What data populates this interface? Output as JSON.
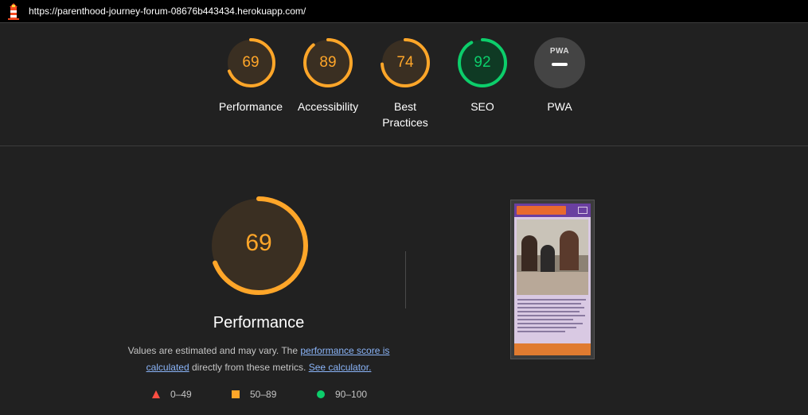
{
  "browser": {
    "url": "https://parenthood-journey-forum-08676b443434.herokuapp.com/"
  },
  "colors": {
    "average": "#ffa629",
    "pass": "#0cce6b",
    "fail": "#ff4e42",
    "link": "#8ab4f8"
  },
  "scores": [
    {
      "label": "Performance",
      "score": 69
    },
    {
      "label": "Accessibility",
      "score": 89
    },
    {
      "label": "Best Practices",
      "score": 74
    },
    {
      "label": "SEO",
      "score": 92
    }
  ],
  "pwa": {
    "label": "PWA",
    "badge_text": "PWA"
  },
  "performance": {
    "score": 69,
    "title": "Performance",
    "desc_1": "Values are estimated and may vary. The ",
    "link_1": "performance score is calculated",
    "desc_2": " directly from these metrics. ",
    "link_2": "See calculator."
  },
  "legend": [
    {
      "range": "0–49",
      "shape": "triangle",
      "icon": "fail-triangle-icon"
    },
    {
      "range": "50–89",
      "shape": "square",
      "icon": "average-square-icon"
    },
    {
      "range": "90–100",
      "shape": "circle",
      "icon": "pass-circle-icon"
    }
  ]
}
